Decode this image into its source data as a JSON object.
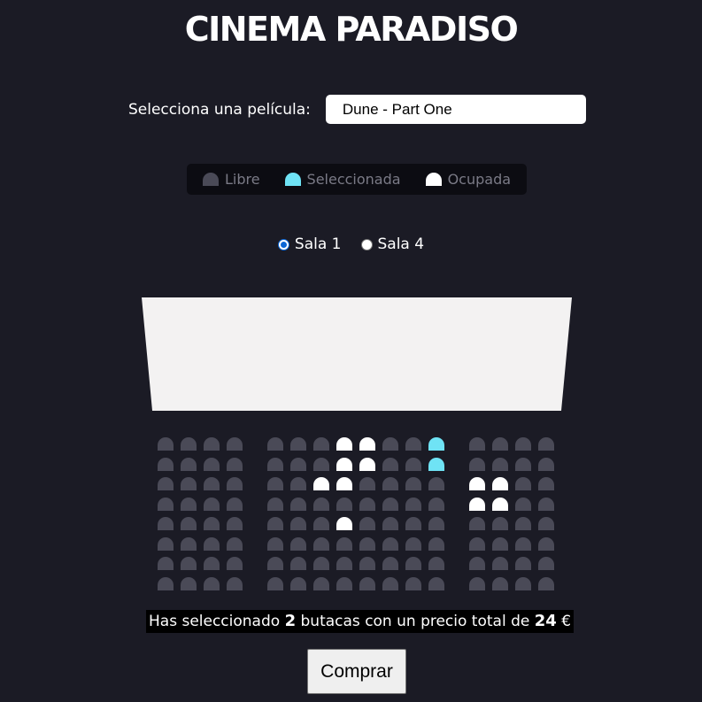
{
  "title": "CINEMA PARADISO",
  "movie": {
    "label": "Selecciona una película:",
    "selected": "Dune - Part One"
  },
  "legend": [
    {
      "label": "Libre",
      "color": "#4a4a57",
      "icon": "seat-free-icon"
    },
    {
      "label": "Seleccionada",
      "color": "#6fe3f5",
      "icon": "seat-selected-icon"
    },
    {
      "label": "Ocupada",
      "color": "#ffffff",
      "icon": "seat-occupied-icon"
    }
  ],
  "rooms": [
    {
      "label": "Sala 1",
      "checked": true
    },
    {
      "label": "Sala 4",
      "checked": false
    }
  ],
  "seat_colors": {
    "free": "#4a4a57",
    "selected": "#6fe3f5",
    "occupied": "#ffffff"
  },
  "seat_map": {
    "rows": 8,
    "columns": 16,
    "blocks": [
      4,
      8,
      4
    ],
    "occupied": [
      [
        0,
        7
      ],
      [
        0,
        8
      ],
      [
        1,
        7
      ],
      [
        1,
        8
      ],
      [
        2,
        6
      ],
      [
        2,
        7
      ],
      [
        2,
        12
      ],
      [
        2,
        13
      ],
      [
        3,
        12
      ],
      [
        3,
        13
      ],
      [
        4,
        7
      ]
    ],
    "selected": [
      [
        0,
        11
      ],
      [
        1,
        11
      ]
    ]
  },
  "summary": {
    "prefix": "Has seleccionado",
    "count": "2",
    "middle": "butacas con un precio total de",
    "total": "24",
    "currency": "€"
  },
  "buy_button": "Comprar"
}
